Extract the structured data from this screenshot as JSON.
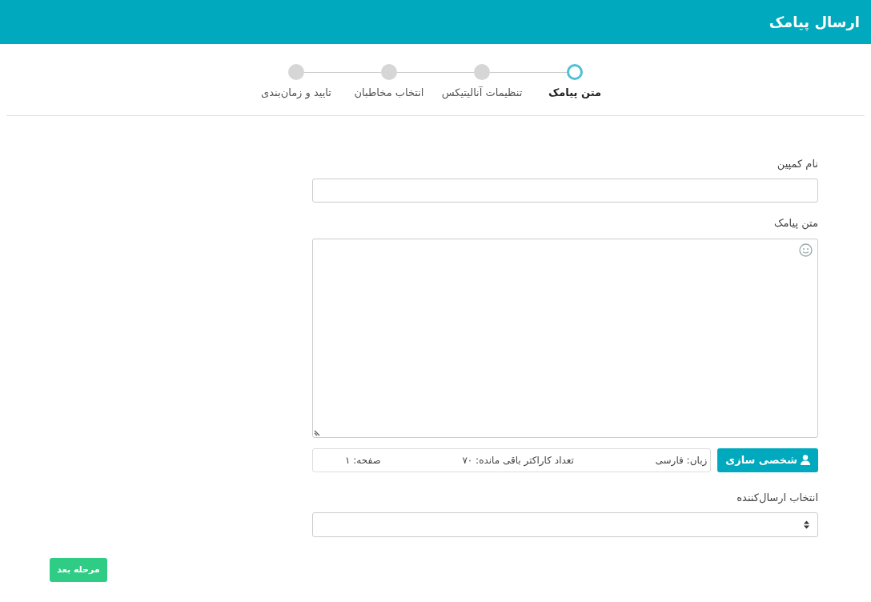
{
  "header": {
    "title": "ارسال پیامک"
  },
  "steps": [
    {
      "label": "متن پیامک",
      "selected": true
    },
    {
      "label": "تنظیمات آنالیتیکس",
      "selected": false
    },
    {
      "label": "انتخاب مخاطبان",
      "selected": false
    },
    {
      "label": "تایید و زمان‌بندی",
      "selected": false
    }
  ],
  "campaign_name": {
    "label": "نام کمپین"
  },
  "message": {
    "label": "متن پیامک"
  },
  "personalize_button": "شخصی سازی",
  "info": {
    "language": "زبان: فارسی",
    "remaining": "تعداد کاراکتر باقی مانده: ۷۰",
    "pages": "صفحه: ۱"
  },
  "sender": {
    "label": "انتخاب ارسال‌کننده"
  },
  "next_button": "مرحله بعد"
}
